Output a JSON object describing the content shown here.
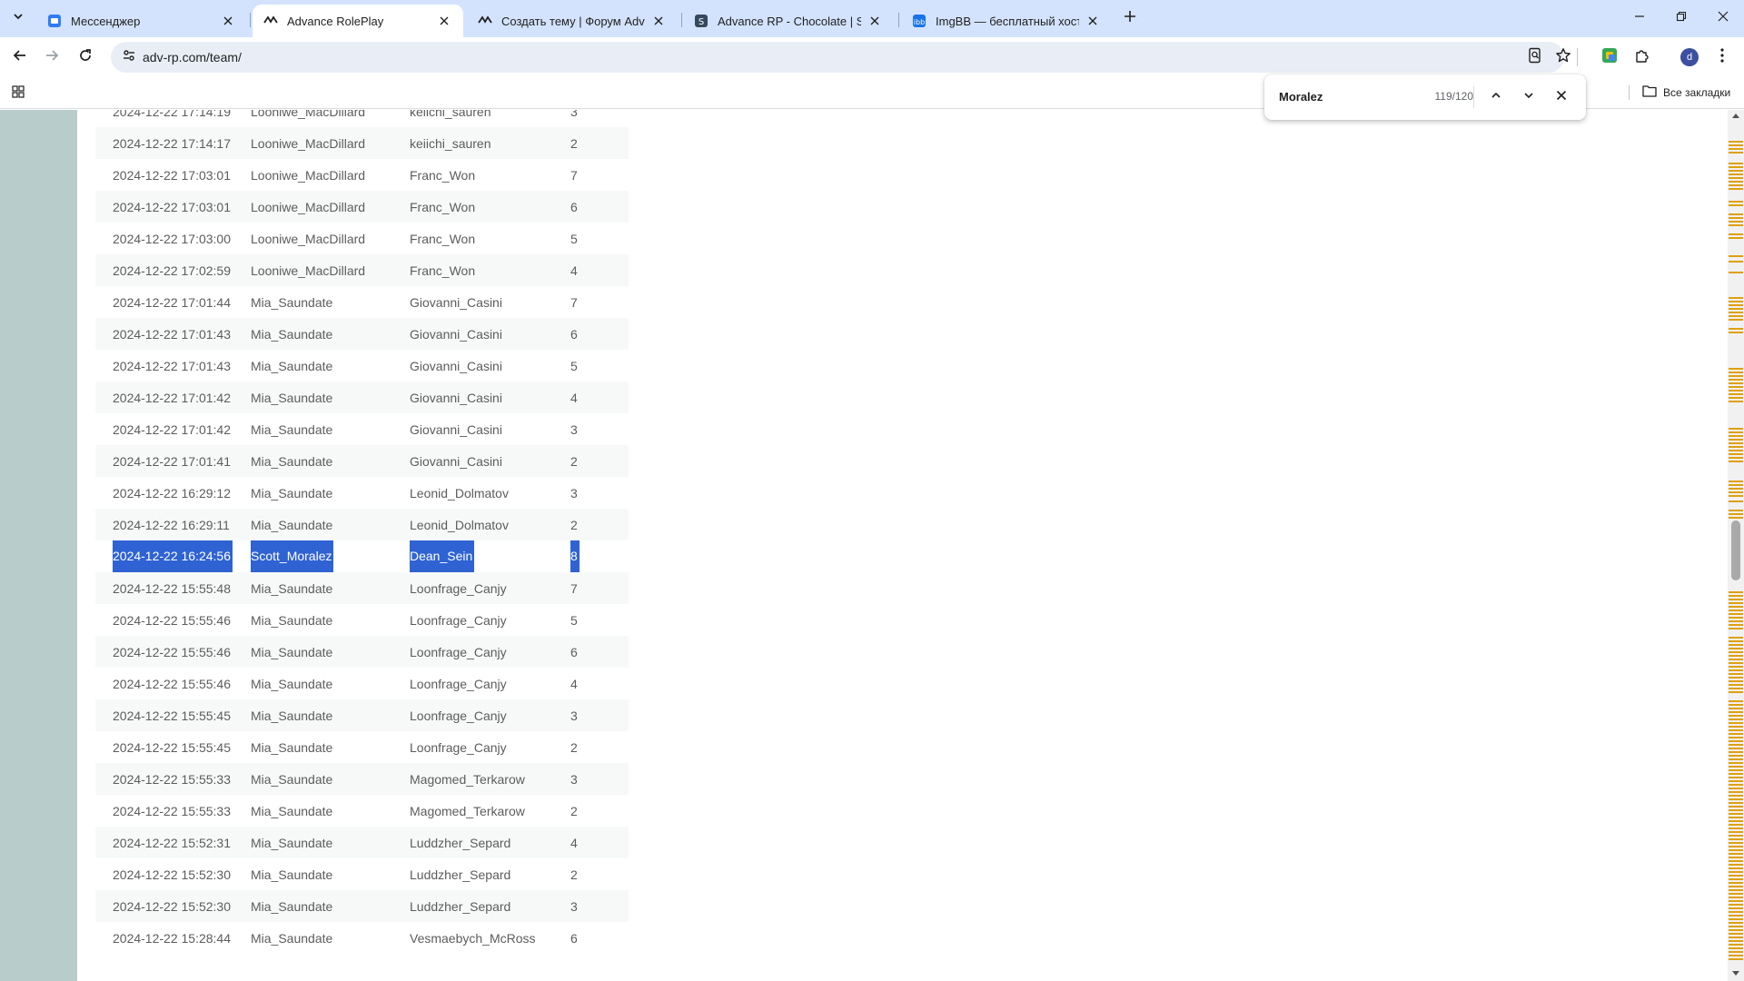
{
  "browser": {
    "tabs": [
      {
        "title": "Мессенджер",
        "icon": "messenger-icon",
        "active": false
      },
      {
        "title": "Advance RolePlay",
        "icon": "advance-rp-icon",
        "active": true
      },
      {
        "title": "Создать тему | Форум Advance",
        "icon": "advance-rp-icon",
        "active": false
      },
      {
        "title": "Advance RP - Chocolate | SAMP",
        "icon": "samp-icon",
        "active": false
      },
      {
        "title": "ImgBB — бесплатный хостинг",
        "icon": "imgbb-icon",
        "active": false
      }
    ],
    "url": "adv-rp.com/team/",
    "avatar_letter": "d",
    "all_bookmarks_label": "Все закладки"
  },
  "find_bar": {
    "query": "Moralez",
    "count": "119/120"
  },
  "table": {
    "rows": [
      {
        "date": "2024-12-22 17:14:19",
        "admin": "Looniwe_MacDillard",
        "player": "keiichi_sauren",
        "level": "3"
      },
      {
        "date": "2024-12-22 17:14:17",
        "admin": "Looniwe_MacDillard",
        "player": "keiichi_sauren",
        "level": "2"
      },
      {
        "date": "2024-12-22 17:03:01",
        "admin": "Looniwe_MacDillard",
        "player": "Franc_Won",
        "level": "7"
      },
      {
        "date": "2024-12-22 17:03:01",
        "admin": "Looniwe_MacDillard",
        "player": "Franc_Won",
        "level": "6"
      },
      {
        "date": "2024-12-22 17:03:00",
        "admin": "Looniwe_MacDillard",
        "player": "Franc_Won",
        "level": "5"
      },
      {
        "date": "2024-12-22 17:02:59",
        "admin": "Looniwe_MacDillard",
        "player": "Franc_Won",
        "level": "4"
      },
      {
        "date": "2024-12-22 17:01:44",
        "admin": "Mia_Saundate",
        "player": "Giovanni_Casini",
        "level": "7"
      },
      {
        "date": "2024-12-22 17:01:43",
        "admin": "Mia_Saundate",
        "player": "Giovanni_Casini",
        "level": "6"
      },
      {
        "date": "2024-12-22 17:01:43",
        "admin": "Mia_Saundate",
        "player": "Giovanni_Casini",
        "level": "5"
      },
      {
        "date": "2024-12-22 17:01:42",
        "admin": "Mia_Saundate",
        "player": "Giovanni_Casini",
        "level": "4"
      },
      {
        "date": "2024-12-22 17:01:42",
        "admin": "Mia_Saundate",
        "player": "Giovanni_Casini",
        "level": "3"
      },
      {
        "date": "2024-12-22 17:01:41",
        "admin": "Mia_Saundate",
        "player": "Giovanni_Casini",
        "level": "2"
      },
      {
        "date": "2024-12-22 16:29:12",
        "admin": "Mia_Saundate",
        "player": "Leonid_Dolmatov",
        "level": "3"
      },
      {
        "date": "2024-12-22 16:29:11",
        "admin": "Mia_Saundate",
        "player": "Leonid_Dolmatov",
        "level": "2"
      },
      {
        "date": "2024-12-22 16:24:56",
        "admin": "Scott_Moralez",
        "player": "Dean_Sein",
        "level": "8",
        "highlighted": true
      },
      {
        "date": "2024-12-22 15:55:48",
        "admin": "Mia_Saundate",
        "player": "Loonfrage_Canjy",
        "level": "7"
      },
      {
        "date": "2024-12-22 15:55:46",
        "admin": "Mia_Saundate",
        "player": "Loonfrage_Canjy",
        "level": "5"
      },
      {
        "date": "2024-12-22 15:55:46",
        "admin": "Mia_Saundate",
        "player": "Loonfrage_Canjy",
        "level": "6"
      },
      {
        "date": "2024-12-22 15:55:46",
        "admin": "Mia_Saundate",
        "player": "Loonfrage_Canjy",
        "level": "4"
      },
      {
        "date": "2024-12-22 15:55:45",
        "admin": "Mia_Saundate",
        "player": "Loonfrage_Canjy",
        "level": "3"
      },
      {
        "date": "2024-12-22 15:55:45",
        "admin": "Mia_Saundate",
        "player": "Loonfrage_Canjy",
        "level": "2"
      },
      {
        "date": "2024-12-22 15:55:33",
        "admin": "Mia_Saundate",
        "player": "Magomed_Terkarow",
        "level": "3"
      },
      {
        "date": "2024-12-22 15:55:33",
        "admin": "Mia_Saundate",
        "player": "Magomed_Terkarow",
        "level": "2"
      },
      {
        "date": "2024-12-22 15:52:31",
        "admin": "Mia_Saundate",
        "player": "Luddzher_Separd",
        "level": "4"
      },
      {
        "date": "2024-12-22 15:52:30",
        "admin": "Mia_Saundate",
        "player": "Luddzher_Separd",
        "level": "2"
      },
      {
        "date": "2024-12-22 15:52:30",
        "admin": "Mia_Saundate",
        "player": "Luddzher_Separd",
        "level": "3"
      },
      {
        "date": "2024-12-22 15:28:44",
        "admin": "Mia_Saundate",
        "player": "Vesmaebych_McRoss",
        "level": "6"
      }
    ]
  },
  "colors": {
    "tabstrip": "#d3e3fd",
    "left_strip": "#b9cccc",
    "find_highlight": "#2f63d3",
    "find_marker": "#e0a010"
  }
}
